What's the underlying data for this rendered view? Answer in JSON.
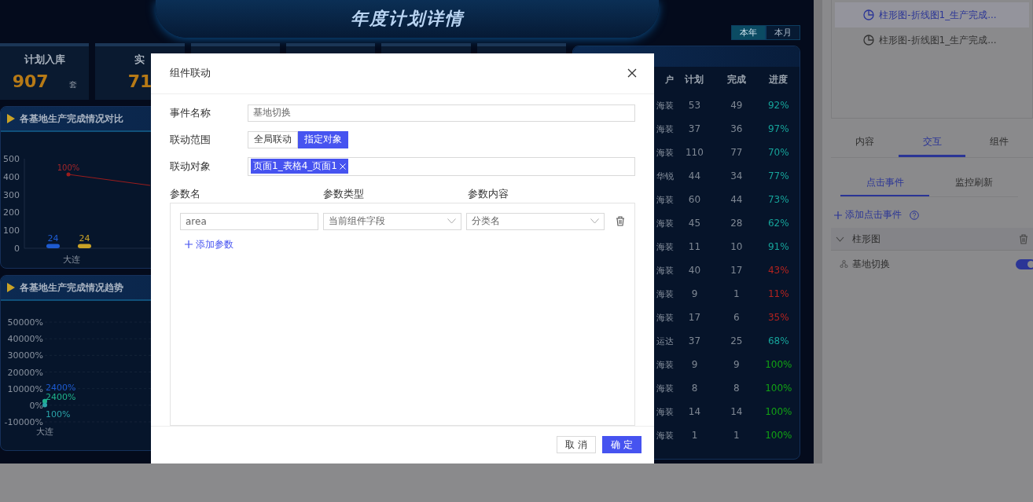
{
  "dashboard": {
    "title": "年度计划详情",
    "period_tabs": [
      {
        "label": "本年",
        "selected": true
      },
      {
        "label": "本月",
        "selected": false
      }
    ],
    "kpis": [
      {
        "label": "计划入库",
        "value": "907",
        "unit": "套"
      },
      {
        "label": "实",
        "value": "71"
      }
    ],
    "compare_panel": {
      "title": "各基地生产完成情况对比",
      "chart_data": {
        "type": "bar",
        "categories": [
          "大连"
        ],
        "series": [
          {
            "color": "#1e5bd0",
            "values": [
              24
            ]
          },
          {
            "color": "#c9a227",
            "values": [
              24
            ]
          }
        ],
        "ylim": [
          0,
          500
        ],
        "yticks": [
          0,
          100,
          200,
          300,
          400,
          500
        ],
        "data_labels": true,
        "annotations": [
          "100%"
        ]
      }
    },
    "trend_panel": {
      "title": "各基地生产完成情况趋势",
      "chart_data": {
        "type": "line",
        "grid": true,
        "categories": [
          "大连"
        ],
        "ylim": [
          -10000,
          50000
        ],
        "yticks": [
          {
            "value": -10000,
            "label": "-10000%"
          },
          {
            "value": 0,
            "label": "0%"
          },
          {
            "value": 10000,
            "label": "10000%"
          },
          {
            "value": 20000,
            "label": "20000%"
          },
          {
            "value": 30000,
            "label": "30000%"
          },
          {
            "value": 40000,
            "label": "40000%"
          },
          {
            "value": 50000,
            "label": "50000%"
          }
        ],
        "series": [
          {
            "color": "#1e5bd0",
            "marker": "circle",
            "values": [
              2400
            ],
            "value_labels": [
              "2400%"
            ]
          },
          {
            "color": "#1fb38a",
            "marker": "circle",
            "values": [
              2400
            ],
            "value_labels": [
              "2400%"
            ]
          },
          {
            "color": "#2aa3a8",
            "marker": "circle",
            "values": [
              100
            ],
            "value_labels": [
              "100%"
            ]
          }
        ]
      }
    },
    "table": {
      "columns": [
        "户",
        "计划",
        "完成",
        "进度"
      ],
      "rows": [
        {
          "customer": "海装",
          "plan": "53",
          "done": "49",
          "progress": "92%",
          "color": "#16a39a"
        },
        {
          "customer": "海装",
          "plan": "37",
          "done": "36",
          "progress": "97%",
          "color": "#16a39a"
        },
        {
          "customer": "海装",
          "plan": "110",
          "done": "77",
          "progress": "70%",
          "color": "#16a39a"
        },
        {
          "customer": "华锐",
          "plan": "44",
          "done": "34",
          "progress": "77%",
          "color": "#16a39a"
        },
        {
          "customer": "海装",
          "plan": "60",
          "done": "44",
          "progress": "73%",
          "color": "#16a39a"
        },
        {
          "customer": "海装",
          "plan": "45",
          "done": "28",
          "progress": "62%",
          "color": "#16a39a"
        },
        {
          "customer": "海装",
          "plan": "11",
          "done": "10",
          "progress": "91%",
          "color": "#16a39a"
        },
        {
          "customer": "海装",
          "plan": "40",
          "done": "17",
          "progress": "43%",
          "color": "#b3231f"
        },
        {
          "customer": "海装",
          "plan": "9",
          "done": "1",
          "progress": "11%",
          "color": "#b3231f"
        },
        {
          "customer": "海装",
          "plan": "17",
          "done": "6",
          "progress": "35%",
          "color": "#b3231f"
        },
        {
          "customer": "运达",
          "plan": "37",
          "done": "25",
          "progress": "68%",
          "color": "#16a39a"
        },
        {
          "customer": "海装",
          "plan": "9",
          "done": "9",
          "progress": "100%",
          "color": "#12a214"
        },
        {
          "customer": "海装",
          "plan": "8",
          "done": "8",
          "progress": "100%",
          "color": "#12a214"
        },
        {
          "customer": "海装",
          "plan": "14",
          "done": "14",
          "progress": "100%",
          "color": "#12a214"
        },
        {
          "customer": "海装",
          "plan": "1",
          "done": "1",
          "progress": "100%",
          "color": "#12a214"
        }
      ]
    }
  },
  "side_panel": {
    "components": [
      {
        "label": "柱形图-折线图1_生产完成...",
        "selected": true
      },
      {
        "label": "柱形图-折线图1_生产完成...",
        "selected": false
      }
    ],
    "tabs": [
      {
        "label": "内容",
        "selected": false
      },
      {
        "label": "交互",
        "selected": true
      },
      {
        "label": "组件",
        "selected": false
      }
    ],
    "subtabs": [
      {
        "label": "点击事件",
        "selected": true
      },
      {
        "label": "监控刷新",
        "selected": false
      }
    ],
    "add_event": "添加点击事件",
    "groups": [
      {
        "label": "柱形图",
        "expanded": true,
        "events": [
          {
            "label": "基地切换",
            "on": true
          }
        ]
      }
    ]
  },
  "dialog": {
    "title": "组件联动",
    "event_name": {
      "label": "事件名称",
      "value": "基地切换"
    },
    "scope": {
      "label": "联动范围",
      "options": [
        {
          "label": "全局联动",
          "selected": false
        },
        {
          "label": "指定对象",
          "selected": true
        }
      ]
    },
    "targets": {
      "label": "联动对象",
      "tags": [
        "页面1_表格4_页面1"
      ]
    },
    "param_columns": [
      "参数名",
      "参数类型",
      "参数内容"
    ],
    "params": [
      {
        "name": "area",
        "type": "当前组件字段",
        "content": "分类名"
      }
    ],
    "add_param": "添加参数",
    "buttons": [
      {
        "label": "取 消",
        "kind": "secondary"
      },
      {
        "label": "确 定",
        "kind": "primary"
      }
    ]
  }
}
